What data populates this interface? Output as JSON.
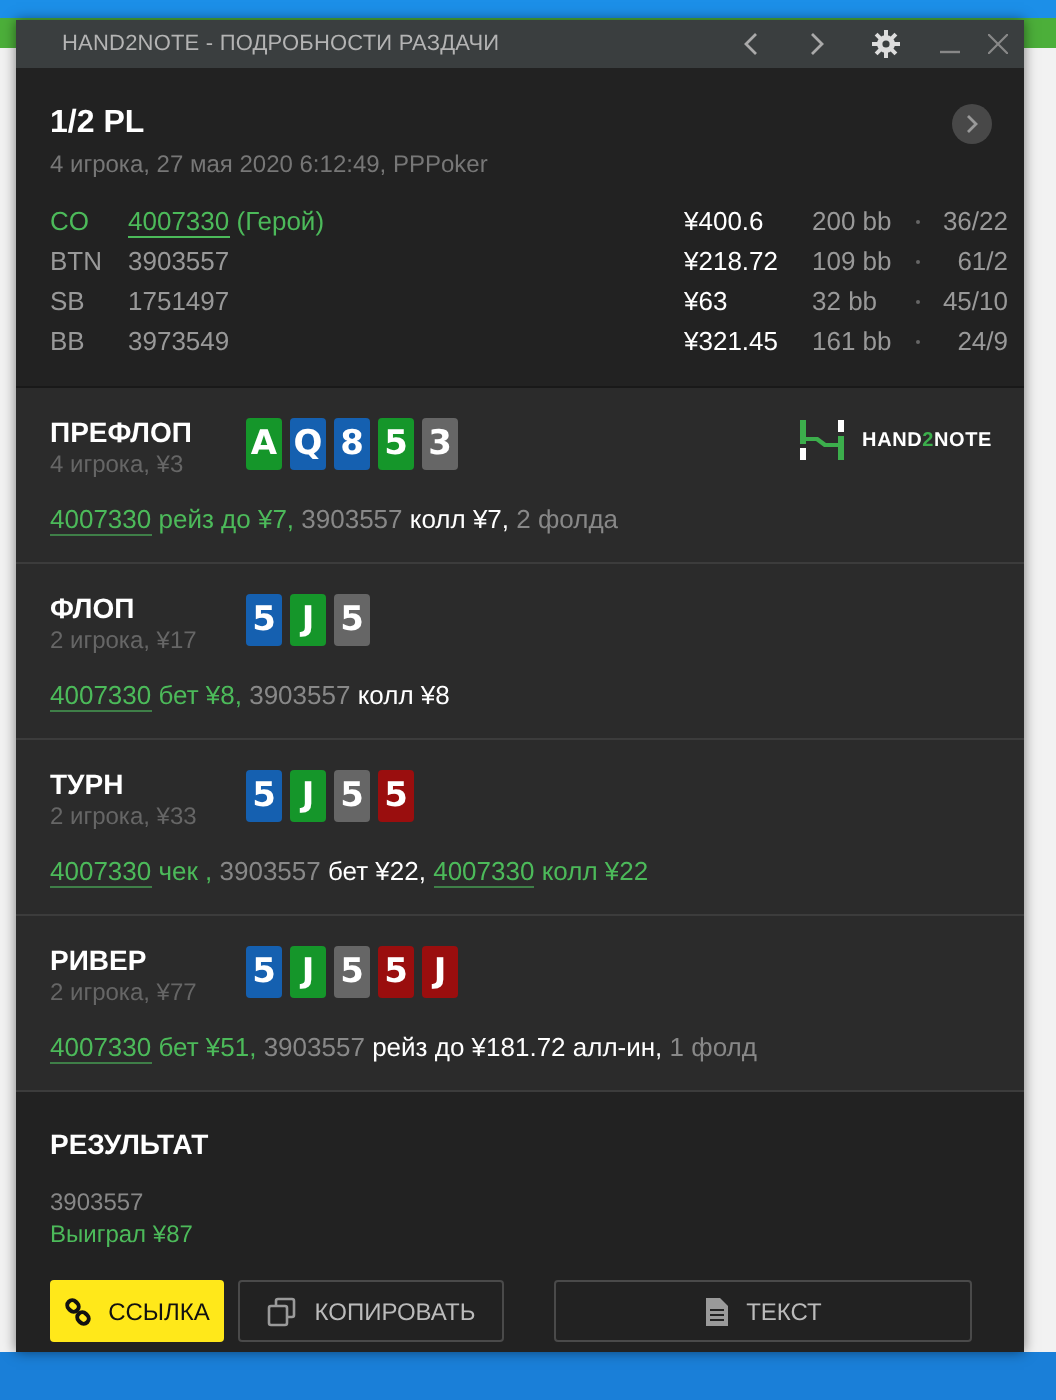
{
  "window": {
    "title": "HAND2NOTE - ПОДРОБНОСТИ РАЗДАЧИ"
  },
  "hand": {
    "title": "1/2 PL",
    "subtitle": "4 игрока, 27 мая 2020 6:12:49, PPPoker"
  },
  "players": [
    {
      "position": "CO",
      "name": "4007330",
      "hero": true,
      "hero_label": "(Герой)",
      "stack": "¥400.6",
      "bb": "200 bb",
      "stat": "36/22"
    },
    {
      "position": "BTN",
      "name": "3903557",
      "hero": false,
      "stack": "¥218.72",
      "bb": "109 bb",
      "stat": "61/2"
    },
    {
      "position": "SB",
      "name": "1751497",
      "hero": false,
      "stack": "¥63",
      "bb": "32 bb",
      "stat": "45/10"
    },
    {
      "position": "BB",
      "name": "3973549",
      "hero": false,
      "stack": "¥321.45",
      "bb": "161 bb",
      "stat": "24/9"
    }
  ],
  "logo": {
    "parts": [
      "HAND",
      "2",
      "NOTE"
    ]
  },
  "streets": [
    {
      "title": "ПРЕФЛОП",
      "subtitle": "4 игрока, ¥3",
      "cards": [
        {
          "rank": "A",
          "color": "#15962a"
        },
        {
          "rank": "Q",
          "color": "#1560b0"
        },
        {
          "rank": "8",
          "color": "#1560b0"
        },
        {
          "rank": "5",
          "color": "#15962a"
        },
        {
          "rank": "3",
          "color": "#666666"
        }
      ],
      "actions": [
        {
          "text": "4007330",
          "kind": "hero_link"
        },
        {
          "text": " рейз до ¥7, ",
          "kind": "hero"
        },
        {
          "text": "3903557",
          "kind": "player"
        },
        {
          "text": " колл ¥7, ",
          "kind": "action"
        },
        {
          "text": "2 фолда",
          "kind": "player"
        }
      ]
    },
    {
      "title": "ФЛОП",
      "subtitle": "2 игрока, ¥17",
      "cards": [
        {
          "rank": "5",
          "color": "#1560b0"
        },
        {
          "rank": "J",
          "color": "#15962a"
        },
        {
          "rank": "5",
          "color": "#666666"
        }
      ],
      "actions": [
        {
          "text": "4007330",
          "kind": "hero_link"
        },
        {
          "text": " бет ¥8, ",
          "kind": "hero"
        },
        {
          "text": "3903557",
          "kind": "player"
        },
        {
          "text": " колл ¥8",
          "kind": "action"
        }
      ]
    },
    {
      "title": "ТУРН",
      "subtitle": "2 игрока, ¥33",
      "cards": [
        {
          "rank": "5",
          "color": "#1560b0"
        },
        {
          "rank": "J",
          "color": "#15962a"
        },
        {
          "rank": "5",
          "color": "#666666"
        },
        {
          "rank": "5",
          "color": "#9a0e0e"
        }
      ],
      "actions": [
        {
          "text": "4007330",
          "kind": "hero_link"
        },
        {
          "text": " чек , ",
          "kind": "hero"
        },
        {
          "text": "3903557",
          "kind": "player"
        },
        {
          "text": " бет ¥22, ",
          "kind": "action"
        },
        {
          "text": "4007330",
          "kind": "hero_link"
        },
        {
          "text": " колл ¥22",
          "kind": "hero"
        }
      ]
    },
    {
      "title": "РИВЕР",
      "subtitle": "2 игрока, ¥77",
      "cards": [
        {
          "rank": "5",
          "color": "#1560b0"
        },
        {
          "rank": "J",
          "color": "#15962a"
        },
        {
          "rank": "5",
          "color": "#666666"
        },
        {
          "rank": "5",
          "color": "#9a0e0e"
        },
        {
          "rank": "J",
          "color": "#9a0e0e"
        }
      ],
      "actions": [
        {
          "text": "4007330",
          "kind": "hero_link"
        },
        {
          "text": " бет ¥51, ",
          "kind": "hero"
        },
        {
          "text": "3903557",
          "kind": "player"
        },
        {
          "text": " рейз до ¥181.72 алл-ин, ",
          "kind": "action"
        },
        {
          "text": "1 фолд",
          "kind": "player"
        }
      ]
    }
  ],
  "result": {
    "title": "РЕЗУЛЬТАТ",
    "player": "3903557",
    "outcome": "Выиграл ¥87"
  },
  "buttons": [
    {
      "label": "ССЫЛКА",
      "kind": "link"
    },
    {
      "label": "КОПИРОВАТЬ",
      "kind": "copy"
    },
    {
      "label": "ТЕКСТ",
      "kind": "text"
    }
  ]
}
